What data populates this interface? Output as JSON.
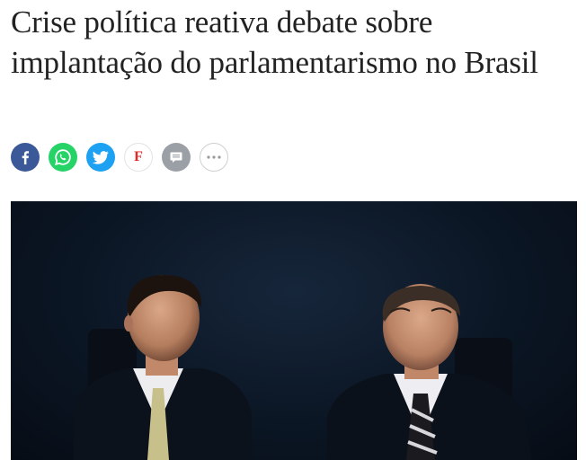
{
  "article": {
    "headline": "Crise política reativa debate sobre implantação do parlamentarismo no Brasil"
  },
  "share": {
    "buttons": [
      {
        "name": "facebook",
        "icon": "facebook-icon",
        "color": "#3b5998"
      },
      {
        "name": "whatsapp",
        "icon": "whatsapp-icon",
        "color": "#25d366"
      },
      {
        "name": "twitter",
        "icon": "twitter-icon",
        "color": "#1da1f2"
      },
      {
        "name": "flipboard",
        "icon": "flipboard-icon",
        "label": "F",
        "color": "#e12828"
      },
      {
        "name": "comment",
        "icon": "comment-icon",
        "color": "#9aa0a6"
      },
      {
        "name": "more",
        "icon": "more-icon",
        "color": "#cfcfcf"
      }
    ]
  },
  "photo": {
    "subject": "two-men-seated-at-event"
  }
}
